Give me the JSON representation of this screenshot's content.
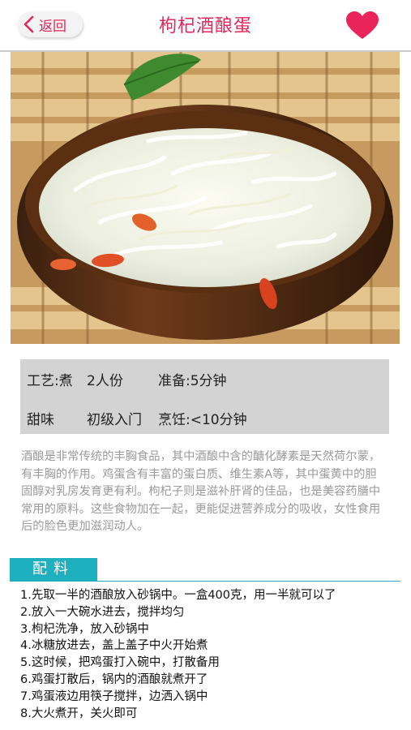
{
  "nav": {
    "back_label": "返回",
    "title": "枸杞酒酿蛋"
  },
  "info": {
    "method": "工艺:煮",
    "servings": "2人份",
    "prep": "准备:5分钟",
    "taste": "甜味",
    "level": "初级入门",
    "cook": "烹饪:<10分钟"
  },
  "description": "酒酿是非常传统的丰胸食品，其中酒酿中含的醣化酵素是天然荷尔蒙，有丰胸的作用。鸡蛋含有丰富的蛋白质、维生素A等，其中蛋黄中的胆固醇对乳房发育更有利。枸杞子则是滋补肝肾的佳品，也是美容药膳中常用的原料。这些食物加在一起，更能促进营养成分的吸收，女性食用后的脸色更加滋润动人。",
  "section_label": "配料",
  "steps": [
    "1.先取一半的酒酿放入砂锅中。一盒400克，用一半就可以了",
    "2.放入一大碗水进去，搅拌均匀",
    "3.枸杞洗净，放入砂锅中",
    "4.冰糖放进去，盖上盖子中火开始煮",
    "5.这时候，把鸡蛋打入碗中，打散备用",
    "6.鸡蛋打散后，锅内的酒酿就煮开了",
    "7.鸡蛋液边用筷子搅拌，边洒入锅中",
    "8.大火煮开，关火即可"
  ],
  "colors": {
    "accent": "#e0285a",
    "section": "#1fb0c0",
    "info_bg": "#d3d3d3"
  },
  "icons": [
    "chevron-left-icon",
    "heart-icon"
  ]
}
